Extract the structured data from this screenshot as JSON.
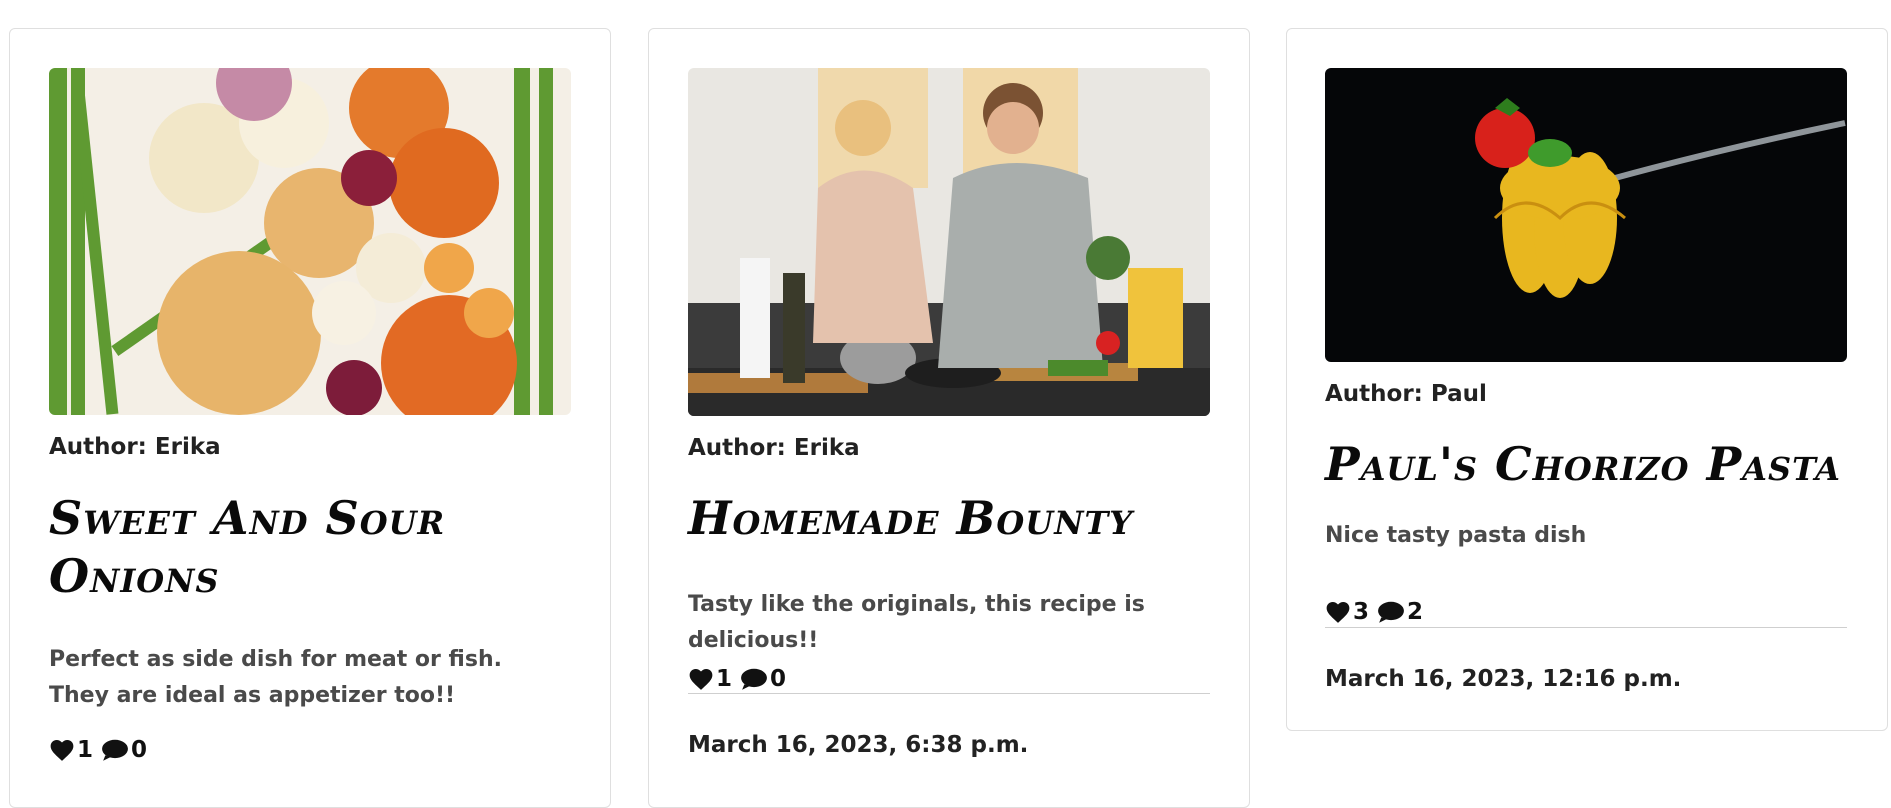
{
  "posts": [
    {
      "author": "Author: Erika",
      "title": "Sweet And Sour Onions",
      "description": "Perfect as side dish for meat or fish. They are ideal as appetizer too!!",
      "likes": "1",
      "comments": "0",
      "image_subject": "onions-photo"
    },
    {
      "author": "Author: Erika",
      "title": "Homemade Bounty",
      "description": "Tasty like the originals, this recipe is delicious!!",
      "likes": "1",
      "comments": "0",
      "date": "March 16, 2023, 6:38 p.m.",
      "image_subject": "couple-cooking-photo"
    },
    {
      "author": "Author: Paul",
      "title": "Paul's Chorizo Pasta",
      "description": "Nice tasty pasta dish",
      "likes": "3",
      "comments": "2",
      "date": "March 16, 2023, 12:16 p.m.",
      "image_subject": "pasta-on-fork-photo"
    }
  ],
  "icons": {
    "like": "heart-icon",
    "comment": "comment-icon"
  }
}
